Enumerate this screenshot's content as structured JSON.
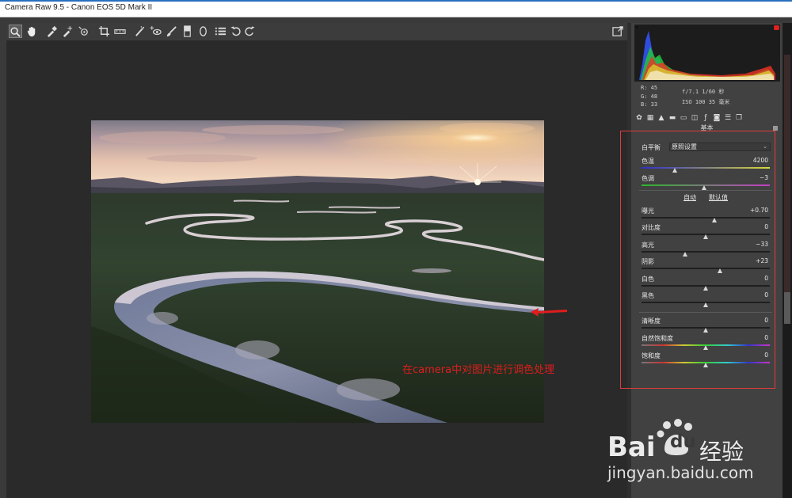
{
  "window": {
    "title": "Camera Raw 9.5  -  Canon EOS 5D Mark II"
  },
  "toolbar": {
    "tools": [
      {
        "name": "zoom-tool",
        "glyph": "🔍"
      },
      {
        "name": "hand-tool",
        "glyph": "✋"
      },
      {
        "name": "white-balance-tool",
        "glyph": "✎"
      },
      {
        "name": "color-sampler-tool",
        "glyph": "✚"
      },
      {
        "name": "targeted-adjustment-tool",
        "glyph": "⊕"
      },
      {
        "name": "crop-tool",
        "glyph": "⌗"
      },
      {
        "name": "straighten-tool",
        "glyph": "▭"
      },
      {
        "name": "spot-removal-tool",
        "glyph": "⁄"
      },
      {
        "name": "red-eye-tool",
        "glyph": "◉"
      },
      {
        "name": "adjustment-brush-tool",
        "glyph": "✐"
      },
      {
        "name": "graduated-filter-tool",
        "glyph": "▮"
      },
      {
        "name": "radial-filter-tool",
        "glyph": "◯"
      },
      {
        "name": "preferences-tool",
        "glyph": "☰"
      },
      {
        "name": "rotate-left-tool",
        "glyph": "↺"
      },
      {
        "name": "rotate-right-tool",
        "glyph": "↻"
      }
    ],
    "fullscreen_glyph": "⇱"
  },
  "readout": {
    "r": "R:  45",
    "g": "G:  48",
    "b": "B:  33",
    "exif_line1": "f/7.1  1/60 秒",
    "exif_line2": "ISO 100  35 毫米"
  },
  "panel": {
    "section_title": "基本",
    "tabs": [
      "basic-tab",
      "tone-curve-tab",
      "detail-tab",
      "hsl-tab",
      "split-toning-tab",
      "lens-corrections-tab",
      "effects-tab",
      "camera-calibration-tab",
      "presets-tab",
      "snapshots-tab"
    ],
    "white_balance_label": "白平衡",
    "white_balance_value": "原照设置",
    "auto_label": "自动",
    "default_label": "默认值",
    "sliders": [
      {
        "label": "色温",
        "value": "4200",
        "pos": 0.26,
        "track": "temp"
      },
      {
        "label": "色调",
        "value": "−3",
        "pos": 0.49,
        "track": "tint"
      },
      {
        "label": "曝光",
        "value": "+0.70",
        "pos": 0.57,
        "track": "plain"
      },
      {
        "label": "对比度",
        "value": "0",
        "pos": 0.5,
        "track": "plain"
      },
      {
        "label": "高光",
        "value": "−33",
        "pos": 0.34,
        "track": "plain"
      },
      {
        "label": "阴影",
        "value": "+23",
        "pos": 0.61,
        "track": "plain"
      },
      {
        "label": "白色",
        "value": "0",
        "pos": 0.5,
        "track": "plain"
      },
      {
        "label": "黑色",
        "value": "0",
        "pos": 0.5,
        "track": "plain"
      },
      {
        "label": "清晰度",
        "value": "0",
        "pos": 0.5,
        "track": "plain"
      },
      {
        "label": "自然饱和度",
        "value": "0",
        "pos": 0.5,
        "track": "spectrum"
      },
      {
        "label": "饱和度",
        "value": "0",
        "pos": 0.5,
        "track": "spectrum"
      }
    ]
  },
  "annotation": {
    "text": "在camera中对图片进行调色处理",
    "color": "#e01c1c"
  },
  "watermark": {
    "brand_a": "Bai",
    "brand_b": "du",
    "brand_cn": "经验",
    "url": "jingyan.baidu.com"
  },
  "colors": {
    "background": "#3a3a3a",
    "preview": "#2a2a2a",
    "highlight_box": "#e23b3b"
  }
}
